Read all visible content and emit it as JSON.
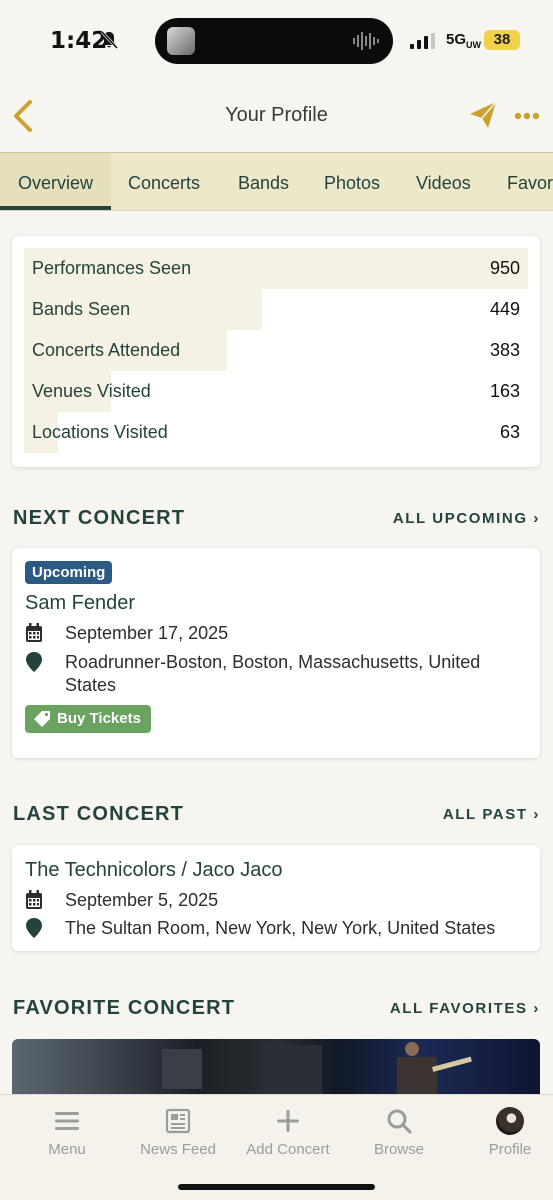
{
  "status_bar": {
    "time": "1:42",
    "network": "5G",
    "network_suffix": "UW",
    "battery": "38"
  },
  "navbar": {
    "title": "Your Profile"
  },
  "tabs": [
    {
      "label": "Overview",
      "active": true
    },
    {
      "label": "Concerts"
    },
    {
      "label": "Bands"
    },
    {
      "label": "Photos"
    },
    {
      "label": "Videos"
    },
    {
      "label": "Favor"
    }
  ],
  "stats": [
    {
      "label": "Performances Seen",
      "value": "950",
      "fill": 1.0
    },
    {
      "label": "Bands Seen",
      "value": "449",
      "fill": 0.473
    },
    {
      "label": "Concerts Attended",
      "value": "383",
      "fill": 0.403
    },
    {
      "label": "Venues Visited",
      "value": "163",
      "fill": 0.172
    },
    {
      "label": "Locations Visited",
      "value": "63",
      "fill": 0.066
    }
  ],
  "next_concert": {
    "heading": "NEXT CONCERT",
    "link": "ALL UPCOMING",
    "badge": "Upcoming",
    "band": "Sam Fender",
    "date": "September 17, 2025",
    "location": "Roadrunner-Boston, Boston, Massachusetts, United States",
    "tickets_label": "Buy Tickets"
  },
  "last_concert": {
    "heading": "LAST CONCERT",
    "link": "ALL PAST",
    "band": "The Technicolors / Jaco Jaco",
    "date": "September 5, 2025",
    "location": "The Sultan Room, New York, New York, United States"
  },
  "favorite_concert": {
    "heading": "FAVORITE CONCERT",
    "link": "ALL FAVORITES"
  },
  "bottom_nav": [
    {
      "label": "Menu",
      "icon": "menu-icon"
    },
    {
      "label": "News Feed",
      "icon": "newspaper-icon"
    },
    {
      "label": "Add Concert",
      "icon": "plus-icon"
    },
    {
      "label": "Browse",
      "icon": "search-icon"
    },
    {
      "label": "Profile",
      "icon": "avatar"
    }
  ],
  "colors": {
    "primary": "#23433c",
    "accent_gold": "#c9a22e",
    "badge_blue": "#2b5a84",
    "ticket_green": "#6aa35f",
    "tab_bg": "#ede8c9"
  }
}
